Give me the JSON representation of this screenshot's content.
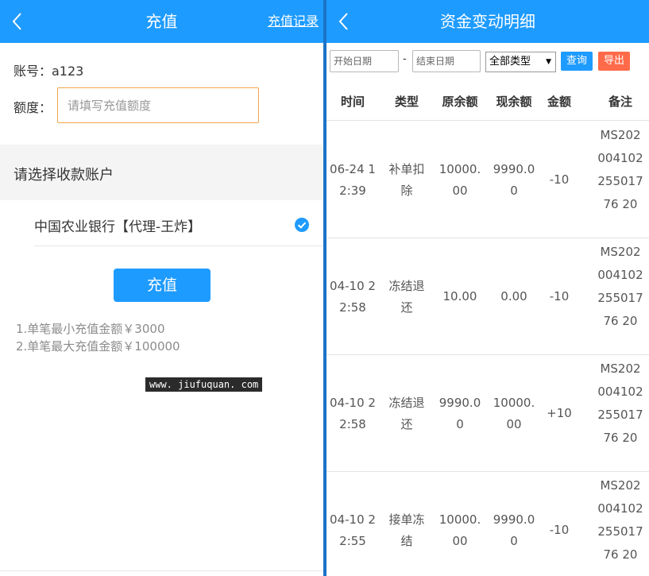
{
  "left": {
    "title": "充值",
    "record_link": "充值记录",
    "account_label": "账号：a123",
    "amount_label": "额度：",
    "amount_placeholder": "请填写充值额度",
    "section_title": "请选择收款账户",
    "bank_name": "中国农业银行【代理-王炸】",
    "submit_label": "充值",
    "notes": [
      "1.单笔最小充值金额￥3000",
      "2.单笔最大充值金额￥100000"
    ],
    "watermark": "www. jiufuquan. com"
  },
  "right": {
    "title": "资金变动明细",
    "filter": {
      "start_placeholder": "开始日期",
      "dash": "-",
      "end_placeholder": "结束日期",
      "type_value": "全部类型",
      "query_label": "查询",
      "export_label": "导出"
    },
    "headers": [
      "时间",
      "类型",
      "原余额",
      "现余额",
      "金额",
      "备注"
    ],
    "rows": [
      {
        "time": "06-24 12:39",
        "type": "补单扣除",
        "before": "10000.00",
        "after": "9990.00",
        "amount": "-10",
        "note": "MS20200410225501776 20"
      },
      {
        "time": "04-10 22:58",
        "type": "冻结退还",
        "before": "10.00",
        "after": "0.00",
        "amount": "-10",
        "note": "MS20200410225501776 20"
      },
      {
        "time": "04-10 22:58",
        "type": "冻结退还",
        "before": "9990.00",
        "after": "10000.00",
        "amount": "+10",
        "note": "MS20200410225501776 20"
      },
      {
        "time": "04-10 22:55",
        "type": "接单冻结",
        "before": "10000.00",
        "after": "9990.00",
        "amount": "-10",
        "note": "MS20200410225501776 20"
      }
    ]
  },
  "colors": {
    "primary": "#1e9bff",
    "export": "#ff6b4a",
    "input_border": "#f0a64a",
    "divider": "#1b73c7"
  }
}
